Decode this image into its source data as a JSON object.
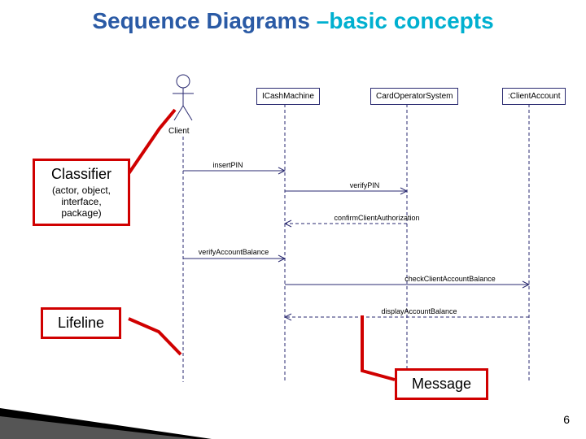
{
  "title": {
    "part1": "Sequence Diagrams",
    "part2": " –basic concepts"
  },
  "participants": {
    "actor": "Client",
    "p1": "ICashMachine",
    "p2": "CardOperatorSystem",
    "p3": ":ClientAccount"
  },
  "messages": {
    "m1": "insertPIN",
    "m2": "verifyPIN",
    "m3": "confirmClientAuthorization",
    "m4": "verifyAccountBalance",
    "m5": "checkClientAccountBalance",
    "m6": "displayAccountBalance"
  },
  "annotations": {
    "classifier": {
      "head": "Classifier",
      "sub": "(actor, object,\ninterface,\npackage)"
    },
    "lifeline": "Lifeline",
    "message": "Message"
  },
  "page": "6"
}
